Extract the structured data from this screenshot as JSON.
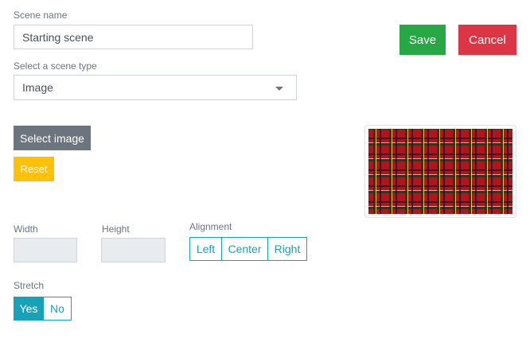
{
  "scene_name": {
    "label": "Scene name",
    "value": "Starting scene"
  },
  "scene_type": {
    "label": "Select a scene type",
    "selected": "Image"
  },
  "actions": {
    "save_label": "Save",
    "cancel_label": "Cancel"
  },
  "image": {
    "select_label": "Select image",
    "reset_label": "Reset",
    "preview_icon": "tartan-image-preview"
  },
  "dimensions": {
    "width_label": "Width",
    "width_value": "",
    "height_label": "Height",
    "height_value": ""
  },
  "alignment": {
    "label": "Alignment",
    "options": [
      "Left",
      "Center",
      "Right"
    ],
    "selected": ""
  },
  "stretch": {
    "label": "Stretch",
    "options": [
      "Yes",
      "No"
    ],
    "selected": "Yes"
  },
  "colors": {
    "save": "#28a745",
    "cancel": "#dc3545",
    "secondary": "#6c757d",
    "warning": "#ffc107",
    "info": "#17a2b8"
  }
}
